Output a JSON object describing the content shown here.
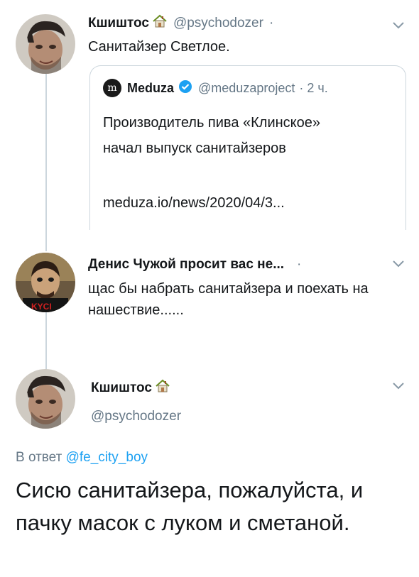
{
  "colors": {
    "accent": "#1da1f2",
    "secondary_text": "#657786",
    "thread_line": "#ccd6dd"
  },
  "tweet1": {
    "avatar_icon": "user-avatar-photo",
    "name": "Кшиштос",
    "name_emoji": "house-emoji",
    "handle": "@psychodozer",
    "separator": "·",
    "text": "Санитайзер Светлое.",
    "quote": {
      "logo_icon": "meduza-logo",
      "name": "Meduza",
      "verified_icon": "verified-badge-icon",
      "handle": "@meduzaproject",
      "time": "· 2 ч.",
      "text": "Производитель пива «Клинское» начал выпуск санитайзеров",
      "link": "meduza.io/news/2020/04/3..."
    }
  },
  "tweet2": {
    "avatar_icon": "user-avatar-illustration",
    "name": "Денис Чужой просит вас не...",
    "separator": "·",
    "text": "щас бы набрать санитайзера и поехать на нашествие......"
  },
  "tweet3": {
    "avatar_icon": "user-avatar-photo",
    "name": "Кшиштос",
    "name_emoji": "house-emoji",
    "handle": "@psychodozer",
    "reply_prefix": "В ответ",
    "reply_mention": "@fe_city_boy",
    "text": "Сисю санитайзера, пожалуйста, и пачку масок с луком и сметаной."
  }
}
